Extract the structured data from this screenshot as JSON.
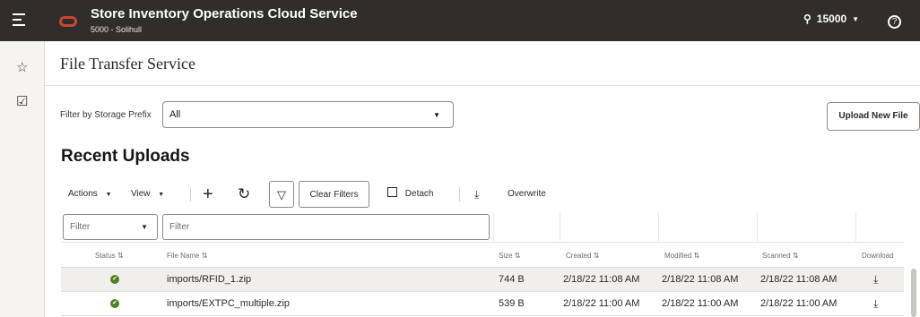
{
  "app": {
    "title": "Store Inventory Operations Cloud Service",
    "store": "5000 - Solihull",
    "user": "15000",
    "help": "?"
  },
  "page": {
    "title": "File Transfer Service"
  },
  "filter": {
    "label": "Filter by Storage Prefix",
    "value": "All"
  },
  "upload_button": "Upload New File",
  "section": {
    "title": "Recent Uploads"
  },
  "toolbar": {
    "actions": "Actions",
    "view": "View",
    "clear_filters": "Clear Filters",
    "detach": "Detach",
    "overwrite": "Overwrite"
  },
  "grid": {
    "filter_select": "Filter",
    "filter_input_placeholder": "Filter",
    "columns": [
      "Status",
      "File Name",
      "Size",
      "Created",
      "Modified",
      "Scanned",
      "Download"
    ],
    "rows": [
      {
        "file": "imports/RFID_1.zip",
        "size": "744 B",
        "created": "2/18/22 11:08 AM",
        "modified": "2/18/22 11:08 AM",
        "scanned": "2/18/22 11:08 AM"
      },
      {
        "file": "imports/EXTPC_multiple.zip",
        "size": "539 B",
        "created": "2/18/22 11:00 AM",
        "modified": "2/18/22 11:00 AM",
        "scanned": "2/18/22 11:00 AM"
      }
    ]
  },
  "colors": {
    "header_bg": "#312d2a",
    "logo": "#c74634",
    "status_ok": "#508223"
  }
}
